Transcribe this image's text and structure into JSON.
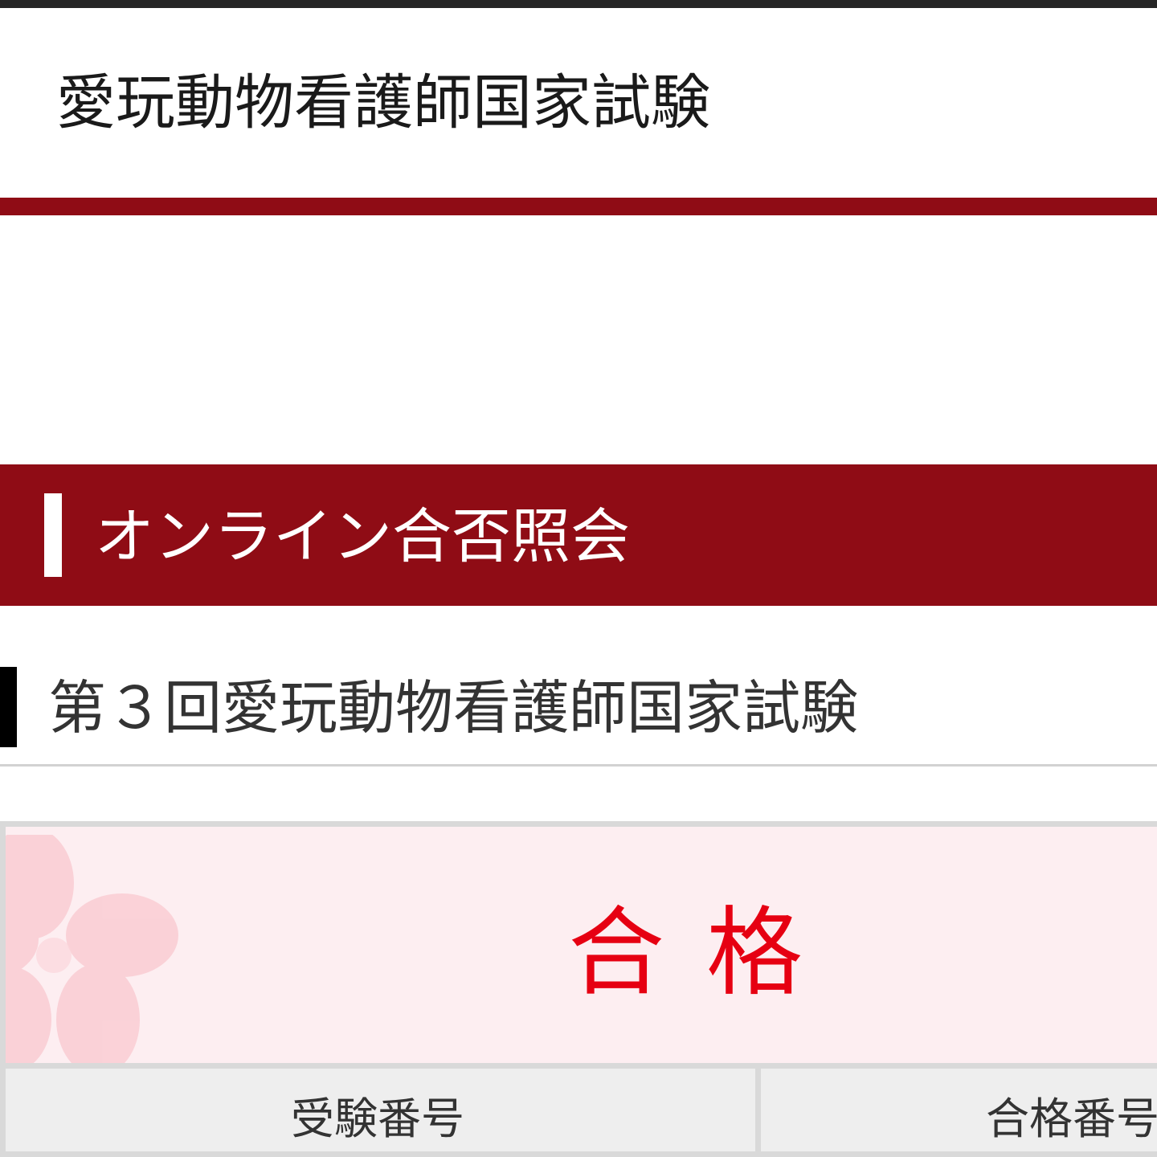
{
  "header": {
    "site_title": "愛玩動物看護師国家試験"
  },
  "section": {
    "title": "オンライン合否照会"
  },
  "exam": {
    "title": "第３回愛玩動物看護師国家試験"
  },
  "result": {
    "status": "合格",
    "status_color": "#e60012",
    "background_motif": "sakura-icon"
  },
  "table": {
    "columns": [
      "受験番号",
      "合格番号"
    ]
  },
  "colors": {
    "brand": "#8f0c15",
    "panel_background": "#fdeef1"
  }
}
